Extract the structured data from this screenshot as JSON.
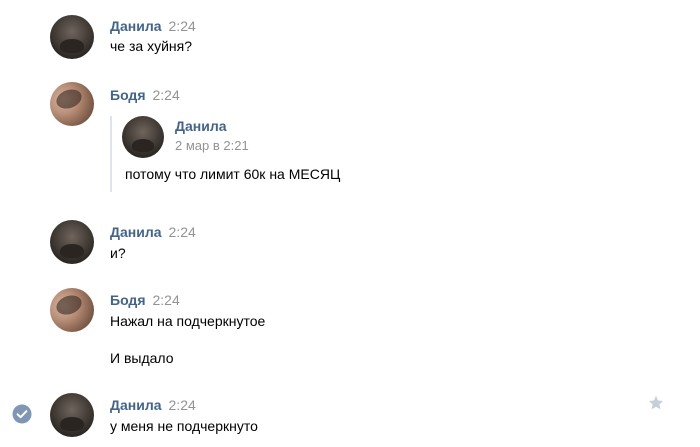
{
  "messages": [
    {
      "author": "Данила",
      "time": "2:24",
      "text": "че за хуйня?"
    },
    {
      "author": "Бодя",
      "time": "2:24",
      "forwarded": {
        "author": "Данила",
        "date": "2 мар в 2:21",
        "text": "потому что лимит 60к на МЕСЯЦ"
      }
    },
    {
      "author": "Данила",
      "time": "2:24",
      "text": "и?"
    },
    {
      "author": "Бодя",
      "time": "2:24",
      "text": "Нажал на подчеркнутое",
      "text2": "И выдало"
    },
    {
      "author": "Данила",
      "time": "2:24",
      "text": "у меня не подчеркнуто"
    }
  ],
  "icons": {
    "selected": "check-circle-icon",
    "favorite": "star-icon"
  },
  "colors": {
    "author_link": "#42648b",
    "timestamp": "#939393",
    "quote_bar": "#dee4eb",
    "check": "#7f97b5",
    "star": "#c6cfd9"
  }
}
